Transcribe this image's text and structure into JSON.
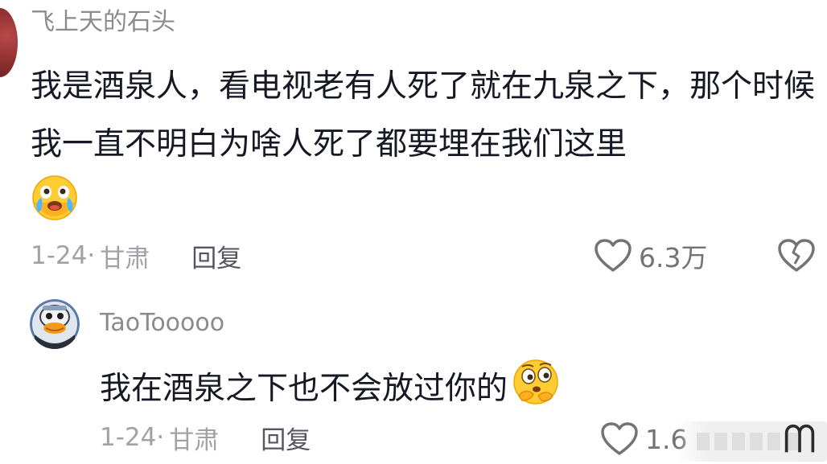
{
  "comment": {
    "username": "飞上天的石头",
    "text": "我是酒泉人，看电视老有人死了就在九泉之下，那个时候我一直不明白为啥人死了都要埋在我们这里",
    "emoji": "crying-laughing-emoji",
    "date": "1-24",
    "separator": "·",
    "location": "甘肃",
    "reply_label": "回复",
    "like_count": "6.3万",
    "reply": {
      "username": "TaoTooooo",
      "text": "我在酒泉之下也不会放过你的",
      "emoji": "thinking-emoji",
      "date": "1-24",
      "separator": "·",
      "location": "甘肃",
      "reply_label": "回复",
      "like_count": "1.6"
    }
  },
  "colors": {
    "text_primary": "#161823",
    "text_secondary": "#8a8b91",
    "meta": "#a1a2a7",
    "reply_button": "#555660",
    "icon": "#727379"
  }
}
